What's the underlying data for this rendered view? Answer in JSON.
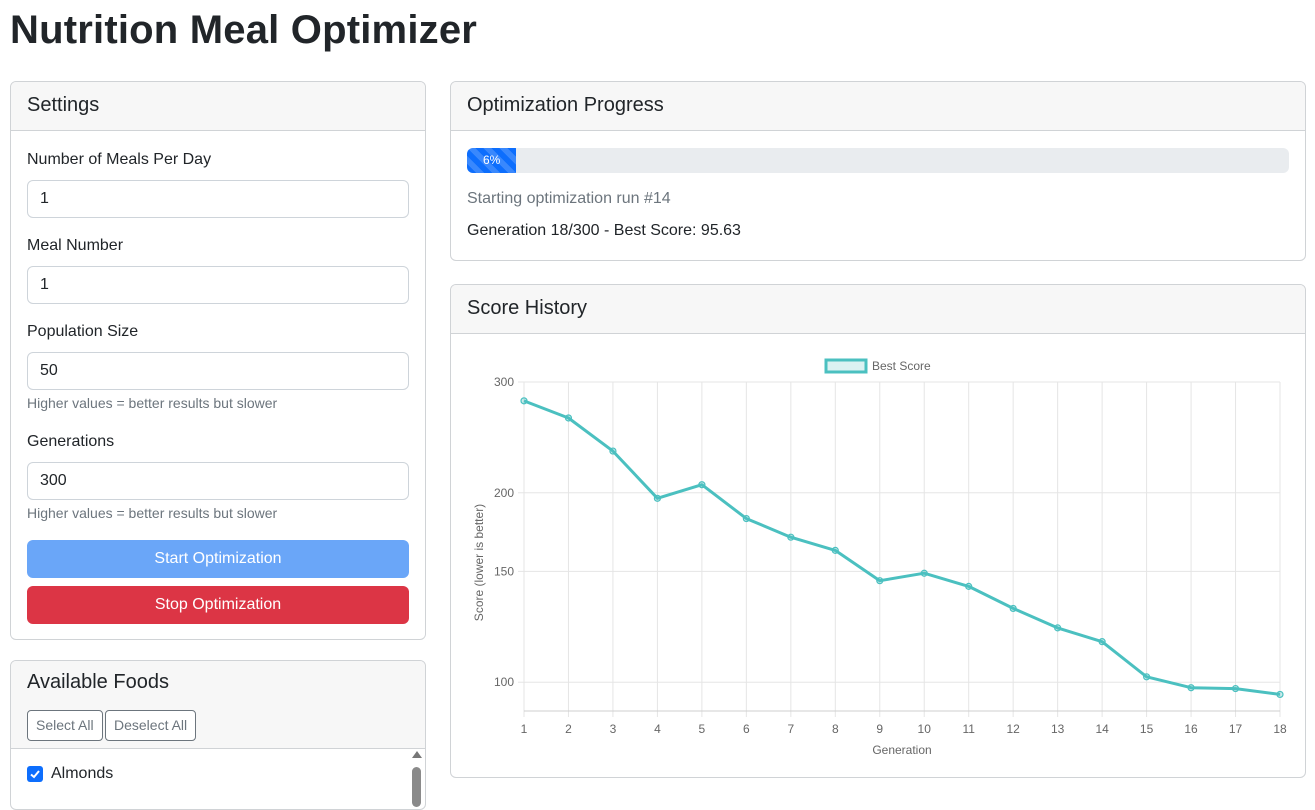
{
  "page": {
    "title": "Nutrition Meal Optimizer"
  },
  "settings": {
    "header": "Settings",
    "meals_label": "Number of Meals Per Day",
    "meals_value": "1",
    "meal_number_label": "Meal Number",
    "meal_number_value": "1",
    "population_label": "Population Size",
    "population_value": "50",
    "population_help": "Higher values = better results but slower",
    "generations_label": "Generations",
    "generations_value": "300",
    "generations_help": "Higher values = better results but slower",
    "start_label": "Start Optimization",
    "stop_label": "Stop Optimization"
  },
  "foods": {
    "header": "Available Foods",
    "select_all": "Select All",
    "deselect_all": "Deselect All",
    "items": [
      {
        "name": "Almonds",
        "checked": true
      }
    ]
  },
  "progress": {
    "header": "Optimization Progress",
    "percent": 6,
    "percent_label": "6%",
    "status": "Starting optimization run #14",
    "generation_text": "Generation 18/300 - Best Score: 95.63"
  },
  "history": {
    "header": "Score History"
  },
  "colors": {
    "line": "#4bc0c0",
    "primary": "#0d6efd",
    "danger": "#dc3545"
  },
  "chart_data": {
    "type": "line",
    "x": [
      1,
      2,
      3,
      4,
      5,
      6,
      7,
      8,
      9,
      10,
      11,
      12,
      13,
      14,
      15,
      16,
      17,
      18
    ],
    "series": [
      {
        "name": "Best Score",
        "values": [
          280,
          263,
          233,
          196,
          206,
          182,
          170,
          162,
          145,
          149,
          142,
          131,
          122,
          116,
          102,
          98,
          97.7,
          95.63
        ]
      }
    ],
    "xlabel": "Generation",
    "ylabel": "Score (lower is better)",
    "yscale": "log",
    "y_ticks": [
      100,
      150,
      200,
      300
    ],
    "ylim": [
      90,
      300
    ],
    "legend": "top",
    "grid": true
  }
}
